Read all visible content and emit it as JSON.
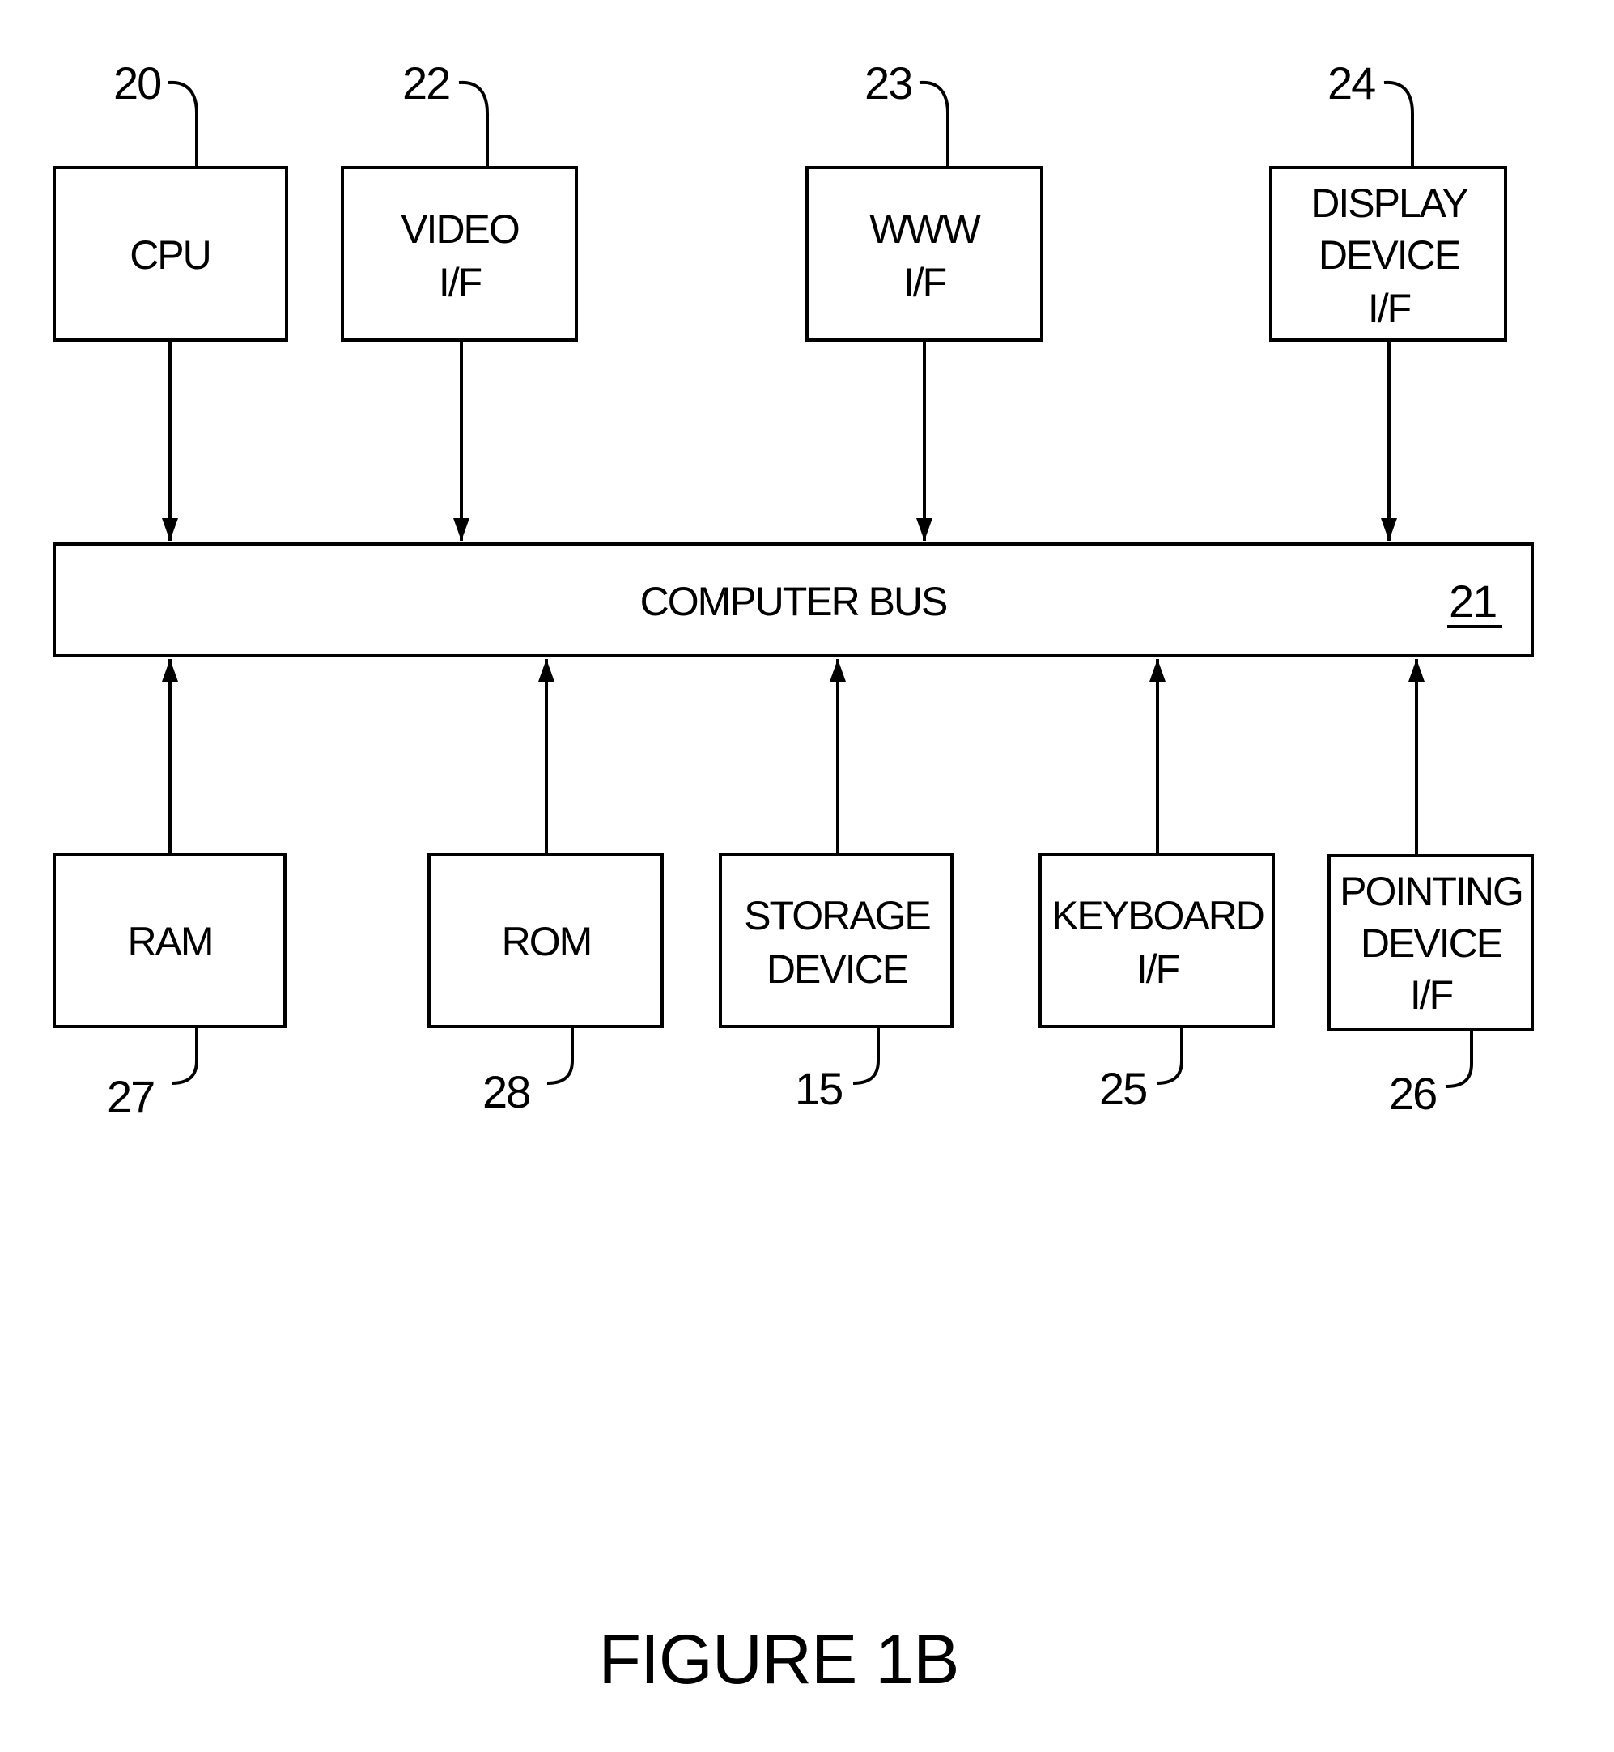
{
  "figure": {
    "caption": "FIGURE 1B",
    "bus": {
      "label": "COMPUTER BUS",
      "ref": "21"
    },
    "top_components": [
      {
        "id": "cpu",
        "lines": [
          "CPU"
        ],
        "ref": "20"
      },
      {
        "id": "video",
        "lines": [
          "VIDEO",
          "I/F"
        ],
        "ref": "22"
      },
      {
        "id": "www",
        "lines": [
          "WWW",
          "I/F"
        ],
        "ref": "23"
      },
      {
        "id": "display",
        "lines": [
          "DISPLAY",
          "DEVICE",
          "I/F"
        ],
        "ref": "24"
      }
    ],
    "bottom_components": [
      {
        "id": "ram",
        "lines": [
          "RAM"
        ],
        "ref": "27"
      },
      {
        "id": "rom",
        "lines": [
          "ROM"
        ],
        "ref": "28"
      },
      {
        "id": "storage",
        "lines": [
          "STORAGE",
          "DEVICE"
        ],
        "ref": "15"
      },
      {
        "id": "keyboard",
        "lines": [
          "KEYBOARD",
          "I/F"
        ],
        "ref": "25"
      },
      {
        "id": "pointing",
        "lines": [
          "POINTING",
          "DEVICE",
          "I/F"
        ],
        "ref": "26"
      }
    ]
  }
}
